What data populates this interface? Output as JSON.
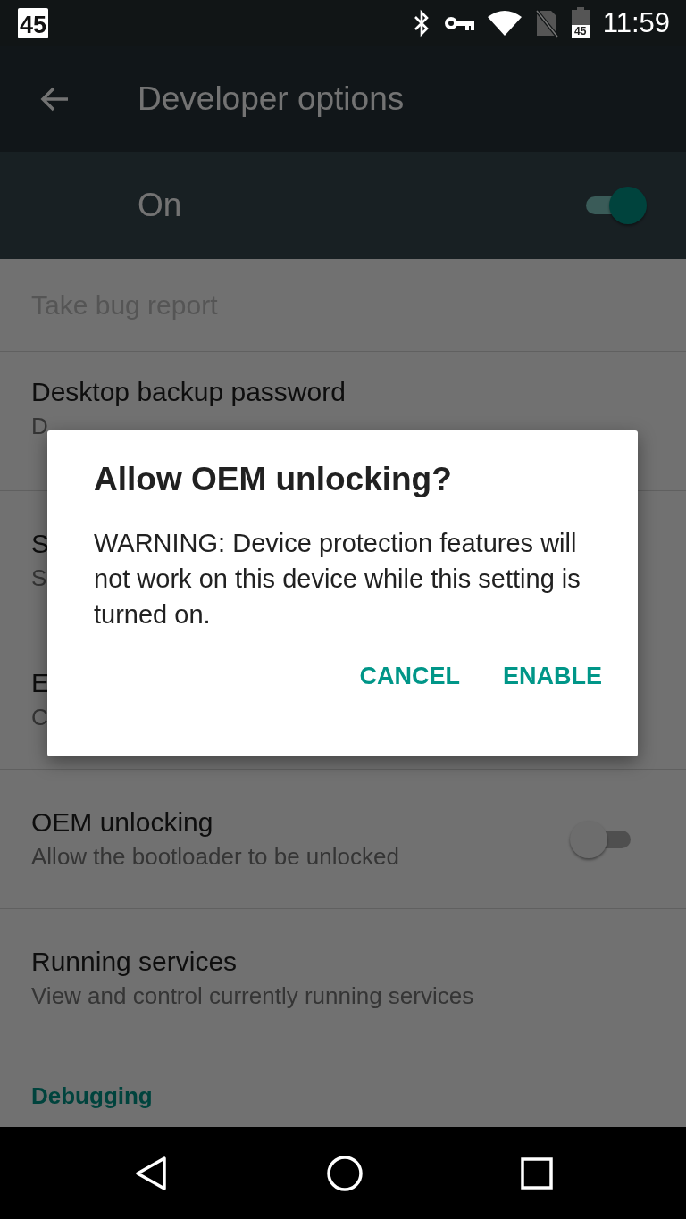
{
  "status_bar": {
    "notification_badge": "45",
    "battery_text": "45",
    "time": "11:59"
  },
  "app_bar": {
    "title": "Developer options"
  },
  "master_switch": {
    "label": "On",
    "on": true
  },
  "settings": [
    {
      "kind": "item",
      "title": "Take bug report",
      "disabled": true
    },
    {
      "kind": "item",
      "title": "Desktop backup password",
      "summary": "D",
      "disabled": false
    },
    {
      "kind": "item",
      "title": "S",
      "summary": "S",
      "disabled": false
    },
    {
      "kind": "item",
      "title": "E",
      "summary": "C",
      "disabled": false
    },
    {
      "kind": "switch",
      "title": "OEM unlocking",
      "summary": "Allow the bootloader to be unlocked",
      "on": false,
      "disabled": false
    },
    {
      "kind": "item",
      "title": "Running services",
      "summary": "View and control currently running services",
      "disabled": false
    },
    {
      "kind": "category",
      "title": "Debugging"
    }
  ],
  "dialog": {
    "title": "Allow OEM unlocking?",
    "message": "WARNING: Device protection features will not work on this device while this setting is turned on.",
    "buttons": [
      "CANCEL",
      "ENABLE"
    ]
  }
}
